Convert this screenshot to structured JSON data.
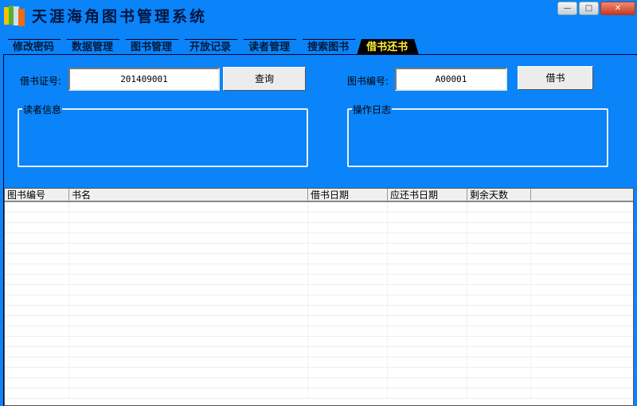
{
  "window": {
    "title": "天涯海角图书管理系统",
    "minimize": "—",
    "maximize": "□",
    "close": "✕"
  },
  "tabs": [
    {
      "label": "修改密码"
    },
    {
      "label": "数据管理"
    },
    {
      "label": "图书管理"
    },
    {
      "label": "开放记录"
    },
    {
      "label": "读者管理"
    },
    {
      "label": "搜索图书"
    },
    {
      "label": "借书还书",
      "active": true
    }
  ],
  "form": {
    "reader_id_label": "借书证号:",
    "reader_id_value": "201409001",
    "query_button": "查询",
    "book_id_label": "图书编号:",
    "book_id_value": "A00001",
    "borrow_button": "借书",
    "reader_info_label": "读者信息",
    "log_label": "操作日志"
  },
  "table": {
    "columns": [
      "图书编号",
      "书名",
      "借书日期",
      "应还书日期",
      "剩余天数",
      ""
    ],
    "rows": []
  },
  "colors": {
    "background": "#0a84f8",
    "active_tab_text": "#ffee33"
  }
}
